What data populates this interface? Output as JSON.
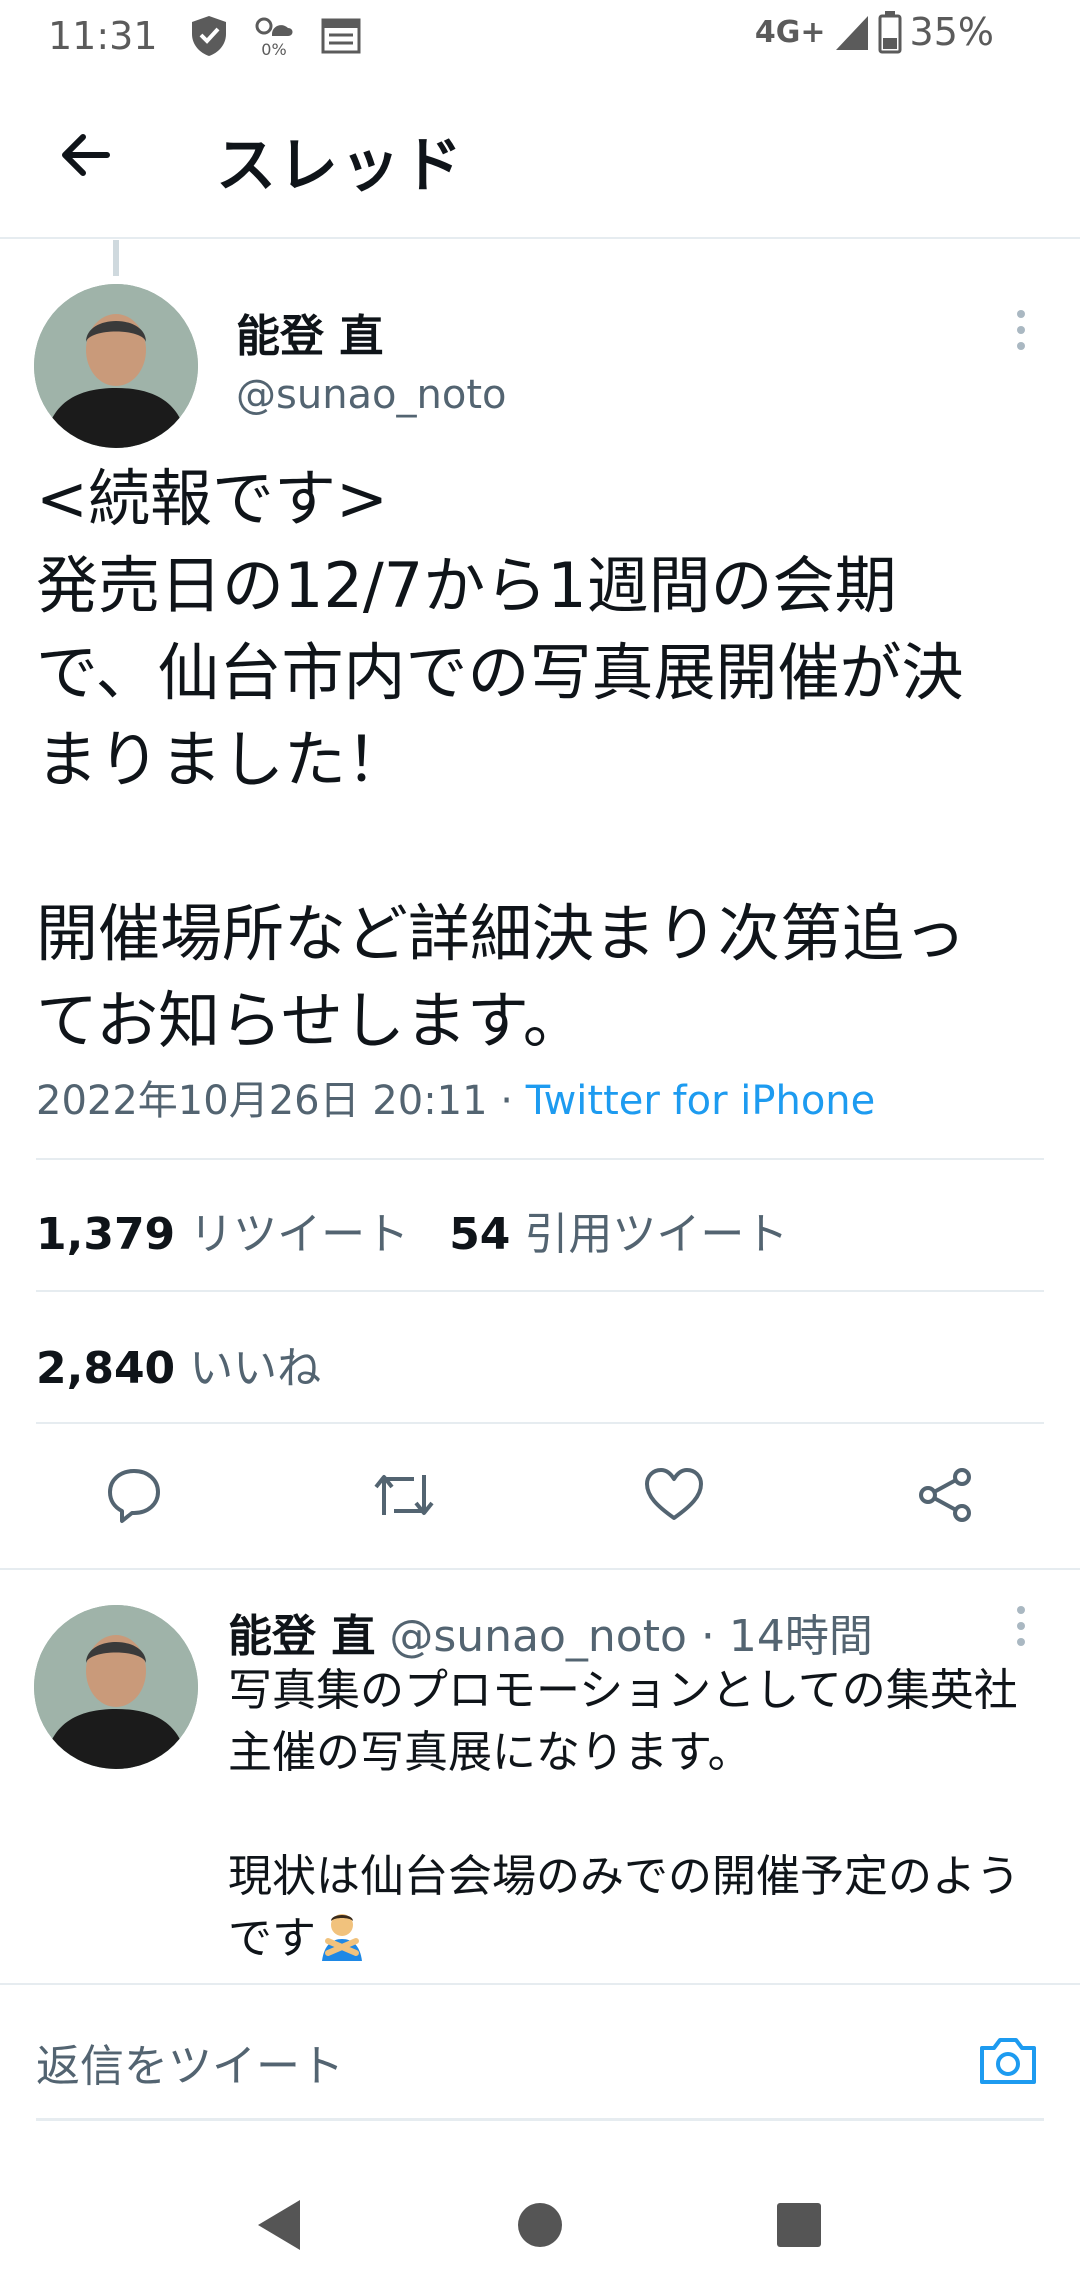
{
  "status_bar": {
    "time": "11:31",
    "data_saver_label": "0%",
    "network": "4G+",
    "battery": "35%"
  },
  "header": {
    "title": "スレッド"
  },
  "tweet": {
    "author_name": "能登 直",
    "author_handle": "@sunao_noto",
    "text": "<続報です>\n発売日の12/7から1週間の会期\nで、仙台市内での写真展開催が決\nまりました！\n\n開催場所など詳細決まり次第追っ\nてお知らせします。",
    "timestamp": "2022年10月26日 20:11",
    "separator": " · ",
    "source": "Twitter for iPhone",
    "retweet_count": "1,379",
    "retweet_label": "リツイート",
    "quote_count": "54",
    "quote_label": "引用ツイート",
    "like_count": "2,840",
    "like_label": "いいね"
  },
  "reply": {
    "author_name": "能登 直",
    "author_handle": "@sunao_noto",
    "time": " · 14時間",
    "text": "写真集のプロモーションとしての集英社\n主催の写真展になります。\n\n現状は仙台会場のみでの開催予定のよう\nです",
    "emoji": "person-gesturing-no"
  },
  "compose": {
    "placeholder": "返信をツイート"
  },
  "colors": {
    "accent": "#1d9bf0",
    "secondary_text": "#536471",
    "divider": "#e6ecf0"
  }
}
